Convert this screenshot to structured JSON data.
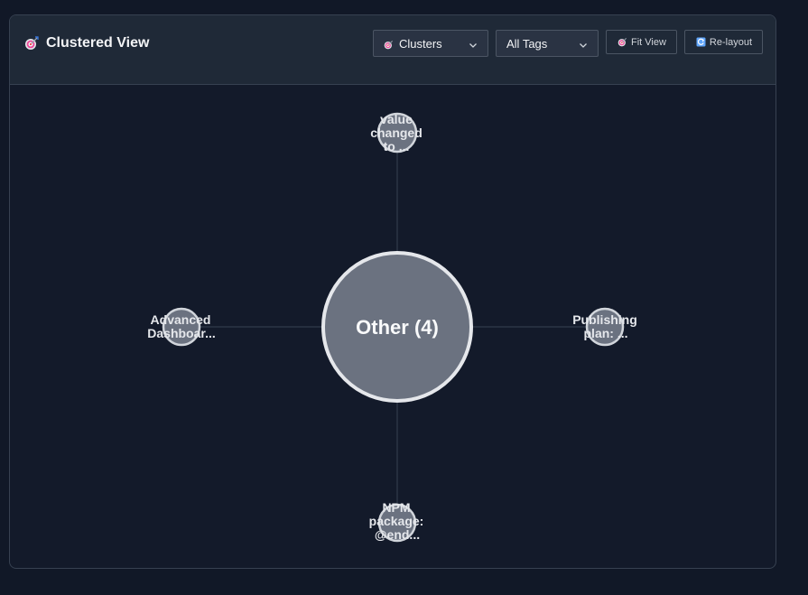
{
  "panel": {
    "title": "Clustered View",
    "title_icon": "target-icon"
  },
  "controls": {
    "view_select": {
      "value": "Clusters",
      "icon": "target-icon"
    },
    "tag_select": {
      "value": "All Tags"
    },
    "fit_view_label": "Fit View",
    "relayout_label": "Re-layout"
  },
  "graph": {
    "center_node": {
      "label": "Other (4)",
      "color": "#6b7280"
    },
    "nodes": [
      {
        "label_lines": [
          "value",
          "changed",
          "to ..."
        ]
      },
      {
        "label_lines": [
          "Advanced",
          "Dashboar..."
        ]
      },
      {
        "label_lines": [
          "Publishing",
          "plan: ..."
        ]
      },
      {
        "label_lines": [
          "NPM",
          "package:",
          "@end..."
        ]
      }
    ]
  },
  "colors": {
    "background": "#111827",
    "panel_header": "#1f2937",
    "node_fill": "#6b7280",
    "node_stroke": "#e5e7eb",
    "edge": "#374151",
    "icon_accent": "#ef4444",
    "refresh_accent": "#60a5fa"
  }
}
